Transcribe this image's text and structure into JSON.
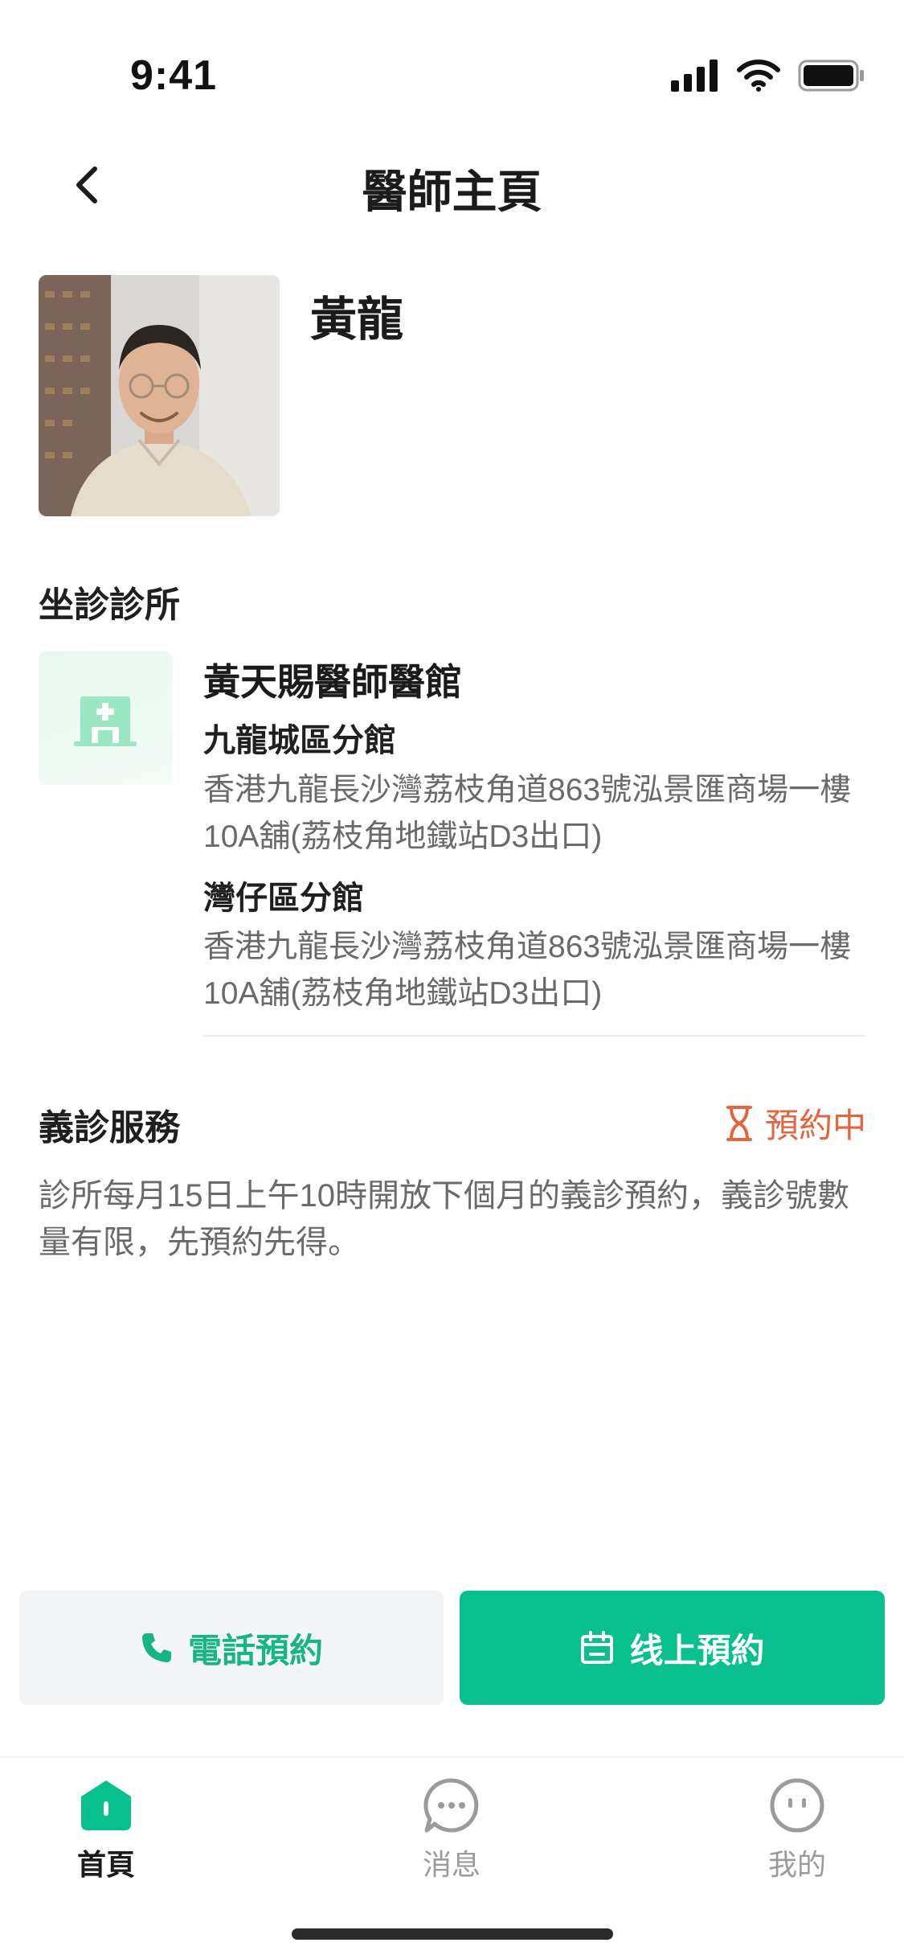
{
  "status_bar": {
    "time": "9:41"
  },
  "nav": {
    "title": "醫師主頁"
  },
  "doctor": {
    "name": "黃龍"
  },
  "clinic_section": {
    "title": "坐診診所",
    "clinic_name": "黃天賜醫師醫館",
    "branches": [
      {
        "name": "九龍城區分館",
        "address": "香港九龍長沙灣荔枝角道863號泓景匯商場一樓10A舖(荔枝角地鐵站D3出口)"
      },
      {
        "name": "灣仔區分館",
        "address": "香港九龍長沙灣荔枝角道863號泓景匯商場一樓10A舖(荔枝角地鐵站D3出口)"
      }
    ]
  },
  "volunteer_section": {
    "title": "義診服務",
    "status": "預約中",
    "description": "診所每月15日上午10時開放下個月的義診預約，義診號數量有限，先預約先得。"
  },
  "actions": {
    "phone_label": "電話預約",
    "online_label": "线上預約"
  },
  "tabbar": {
    "items": [
      {
        "label": "首頁",
        "active": true
      },
      {
        "label": "消息",
        "active": false
      },
      {
        "label": "我的",
        "active": false
      }
    ]
  },
  "colors": {
    "accent": "#07c08e",
    "status_orange": "#e4643e",
    "muted_text": "#6a6a6a"
  }
}
